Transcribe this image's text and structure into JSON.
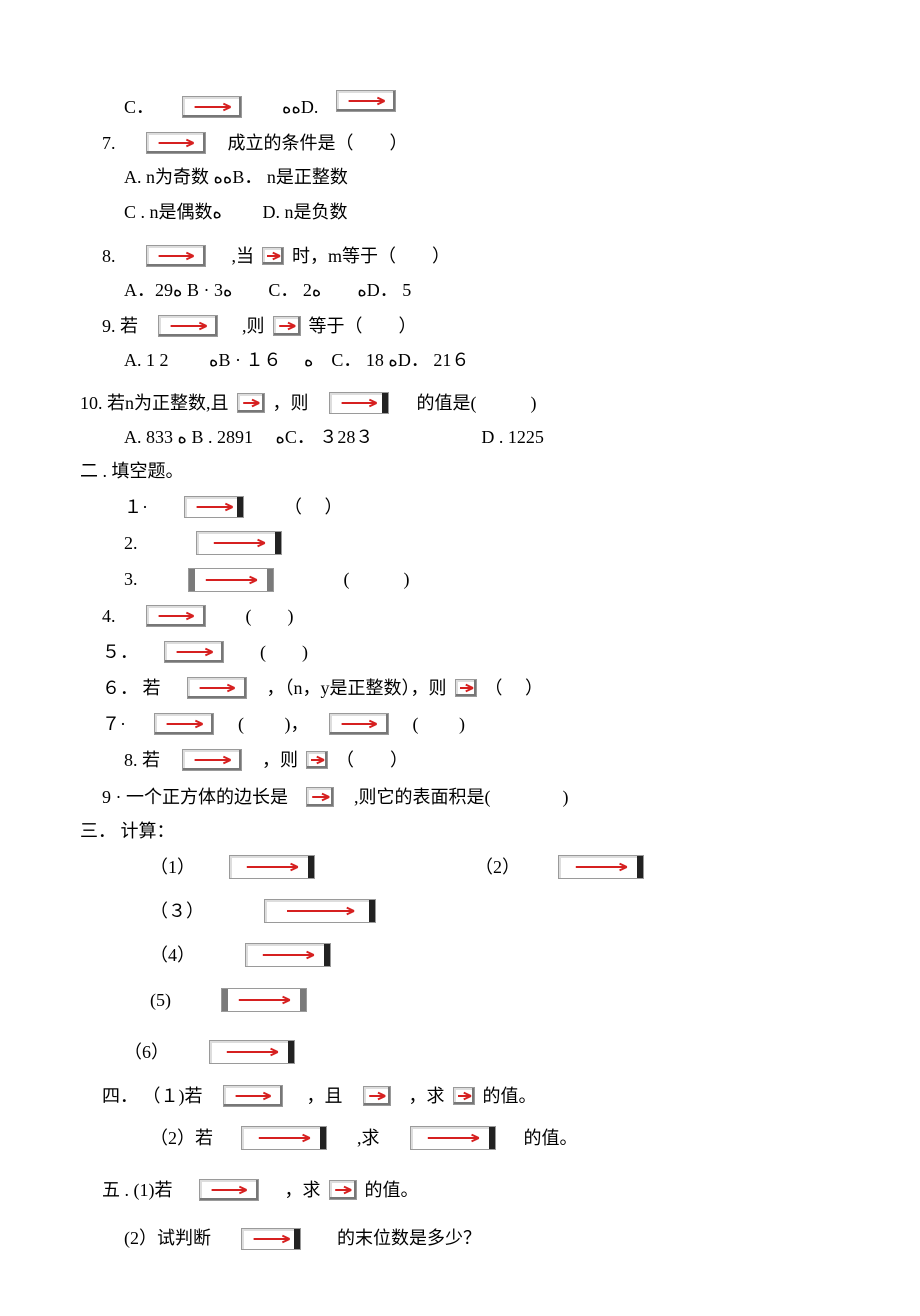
{
  "q6c_prefix": "C．",
  "q6d_prefix": "ﻩﻩD.",
  "q7": {
    "num": "7.",
    "text": "成立的条件是（　　）",
    "a": "A. n为奇数 ﻩﻩB．  n是正整数",
    "c": "C . n是偶数ﻩ　　 D. n是负数"
  },
  "q8": {
    "num": "8.",
    "text": ",当",
    "t2": "时，m等于（　　）",
    "opts": "A．29ﻩ B · 3ﻩ　　C．  2ﻩ　　ﻩD．  5"
  },
  "q9": {
    "num": "9. 若",
    "t1": ",则",
    "t2": "等于（　　）",
    "opts": "A.  1 2　　  ﻩB · １６　 ﻩ　C．  18 ﻩD．  21６"
  },
  "q10": {
    "num": "10. 若n为正整数,且",
    "t1": "，则",
    "t2": "的值是(　　　)",
    "opts": "A. 833  ﻩ  B . 2891　 ﻩC．  ３28３　　　　　　D . 1225"
  },
  "sec2": "二 . 填空题。",
  "f1": "１·",
  "f1t": "（　 ）",
  "f2": "2.",
  "f3": "3.",
  "f3t": "(　　　)",
  "f4": "4.",
  "f4t": "(　　)",
  "f5": "５．",
  "f5t": "(　　)",
  "f6": "６． 若",
  "f6m": "，（n，y是正整数），则",
  "f6e": "（　 ）",
  "f7": "７·",
  "f7a": "(　　 )，",
  "f7b": "(　　 )",
  "f8": "8.  若",
  "f8m": "，则",
  "f8e": "（　　）",
  "f9": "9 · 一个正方体的边长是",
  "f9e": ",则它的表面积是(　　　　)",
  "sec3": "三．  计算：",
  "c1": "（1）",
  "c2": "（2）",
  "c3": "（３）",
  "c4": "（4）",
  "c5": "(5)",
  "c6": "（6）",
  "sec4a": "四．  （１)若",
  "sec4a2": "，且",
  "sec4a3": "，求",
  "sec4a4": "的值。",
  "sec4b": "（2）若",
  "sec4b2": ",求",
  "sec4b3": "的值。",
  "sec5a": "五 . (1)若",
  "sec5a2": "，求",
  "sec5a3": "的值。",
  "sec5b": "(2）试判断",
  "sec5b2": "的末位数是多少？"
}
